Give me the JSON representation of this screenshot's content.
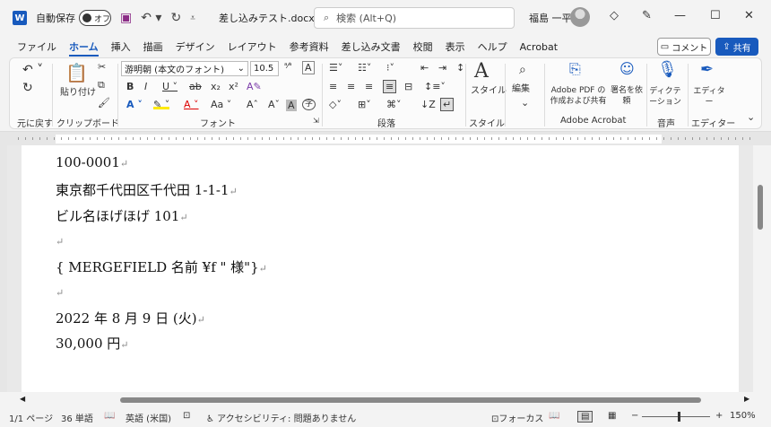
{
  "titlebar": {
    "autosave_label": "自動保存",
    "toggle_label": "オフ",
    "doc_title": "差し込みテスト.docx",
    "search_placeholder": "検索 (Alt+Q)",
    "user_name": "福島 一平"
  },
  "menu": [
    "ファイル",
    "ホーム",
    "挿入",
    "描画",
    "デザイン",
    "レイアウト",
    "参考資料",
    "差し込み文書",
    "校閲",
    "表示",
    "ヘルプ",
    "Acrobat"
  ],
  "menu_active": "ホーム",
  "buttons": {
    "comment": "コメント",
    "share": "共有"
  },
  "ribbon": {
    "undo_group": "元に戻す",
    "paste": "貼り付け",
    "clipboard_group": "クリップボード",
    "font_name": "游明朝 (本文のフォント)",
    "font_size": "10.5",
    "font_group": "フォント",
    "paragraph_group": "段落",
    "style_label": "スタイル",
    "style_group": "スタイル",
    "edit_label": "編集",
    "acrobat_btn1": "Adobe PDF の作成および共有",
    "acrobat_btn2": "署名を依頼",
    "acrobat_group": "Adobe Acrobat",
    "dictation": "ディクテーション",
    "voice_group": "音声",
    "editor": "エディター",
    "editor_group": "エディター"
  },
  "document": {
    "lines": [
      "100-0001",
      "東京都千代田区千代田 1-1-1",
      "ビル名ほげほげ 101",
      "",
      "{ MERGEFIELD 名前 ¥f \" 様\"}",
      "",
      "2022 年 8 月 9 日 (火)",
      "30,000 円"
    ]
  },
  "status": {
    "page": "1/1 ページ",
    "words": "36 単語",
    "language": "英語 (米国)",
    "accessibility": "アクセシビリティ: 問題ありません",
    "focus": "フォーカス",
    "zoom": "150%"
  },
  "colors": {
    "accent": "#185abd"
  }
}
